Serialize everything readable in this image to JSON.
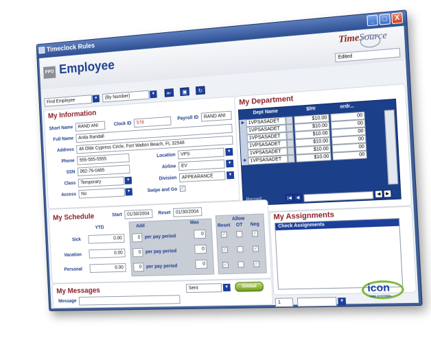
{
  "window": {
    "title": "Timeclock Rules",
    "controls": [
      "_",
      "□",
      "X"
    ]
  },
  "header": {
    "fpo": "FPO",
    "title": "Employee",
    "logo_part1": "Time",
    "logo_part2": "Source",
    "status": "Edited"
  },
  "toolbar": {
    "find_employee": "Find Employee",
    "sort_by": "(By Number)",
    "button_icons": [
      "prev-icon",
      "save-icon",
      "refresh-icon"
    ]
  },
  "my_information": {
    "title": "My Information",
    "short_name_label": "Short Name",
    "short_name": "RAND ANI",
    "clock_id_label": "Clock ID",
    "clock_id": "578",
    "payroll_id_label": "Payroll ID",
    "payroll_id": "RAND ANI",
    "full_name_label": "Full Name",
    "full_name": "Anita Randall",
    "address_label": "Address",
    "address": "48 Olde Cypress Circle, Fort Walton Beach, FL 32548",
    "phone_label": "Phone",
    "phone": "555-555-5555",
    "ssn_label": "SSN",
    "ssn": "082-76-0485",
    "class_label": "Class",
    "class": "Temporary",
    "access_label": "Access",
    "access": "No",
    "location_label": "Location",
    "location": "VPS",
    "airline_label": "Airline",
    "airline": "EV",
    "division_label": "Division",
    "division": "APPEARANCE",
    "swipe_label": "Swipe and Go"
  },
  "my_department": {
    "title": "My Department",
    "columns": [
      "Dept Name",
      "$/Hr",
      "ordr..."
    ],
    "rows": [
      {
        "name": "1VPSASADET",
        "rate": "$10.00",
        "order": "00"
      },
      {
        "name": "1VPSASADET",
        "rate": "$10.00",
        "order": "00"
      },
      {
        "name": "1VPSASADET",
        "rate": "$10.00",
        "order": "00"
      },
      {
        "name": "1VPSASADET",
        "rate": "$10.00",
        "order": "00"
      },
      {
        "name": "1VPSASADET",
        "rate": "$10.00",
        "order": "00"
      },
      {
        "name": "1VPSASADET",
        "rate": "$10.00",
        "order": "00"
      }
    ],
    "record_label": "Record:"
  },
  "my_schedule": {
    "title": "My Schedule",
    "start_label": "Start",
    "start": "01/30/2004",
    "reset_label": "Reset",
    "reset": "01/30/2004",
    "ytd_label": "YTD",
    "add_label": "Add",
    "max_label": "Max",
    "allow_label": "Allow",
    "allow_cols": [
      "Reset",
      "OT",
      "Neg"
    ],
    "per_pay_period": "per pay period",
    "rows": [
      {
        "label": "Sick",
        "ytd": "0.00",
        "add": "0",
        "max": "0"
      },
      {
        "label": "Vacation",
        "ytd": "0.00",
        "add": "0",
        "max": "0"
      },
      {
        "label": "Personal",
        "ytd": "0.00",
        "add": "0",
        "max": "0"
      }
    ]
  },
  "my_assignments": {
    "title": "My Assignments",
    "header": "Check Assignments",
    "page_value": "1"
  },
  "my_messages": {
    "title": "My Messages",
    "message_label": "Message",
    "filter": "Sent",
    "global_button": "Global"
  },
  "footer_logo": {
    "word": "icon",
    "sub": "TIME SYSTEMS."
  },
  "colors": {
    "accent_blue": "#1c3f9c",
    "section_red": "#8c1f2a",
    "window_frame": "#3f5f97"
  }
}
